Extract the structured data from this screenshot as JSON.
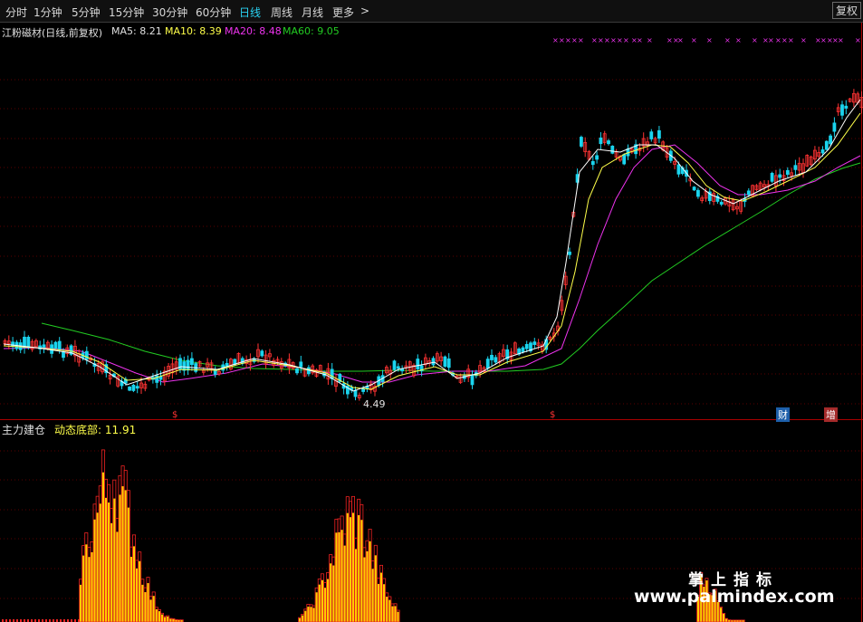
{
  "toolbar": {
    "periods": [
      "分时",
      "1分钟",
      "5分钟",
      "15分钟",
      "30分钟",
      "60分钟",
      "日线",
      "周线",
      "月线",
      "更多"
    ],
    "more_arrow": ">",
    "fuquan": "复权"
  },
  "main": {
    "title": "江粉磁材(日线,前复权)",
    "ma5": "MA5: 8.21",
    "ma10": "MA10: 8.39",
    "ma20": "MA20: 8.48",
    "ma60": "MA60: 9.05",
    "low_label": "4.49",
    "s_mark": "$",
    "cai_mark": "财",
    "zeng_mark": "增",
    "colors": {
      "up": "#ff3333",
      "down": "#1ad4ee",
      "ma5": "#ffffff",
      "ma10": "#ffff4a",
      "ma20": "#ee33ee",
      "ma60": "#22cc22"
    }
  },
  "sub": {
    "title": "主力建仓",
    "indicator": "动态底部: 11.91"
  },
  "watermark": {
    "line1": "掌上指标",
    "line2": "www.palmindex.com"
  }
}
